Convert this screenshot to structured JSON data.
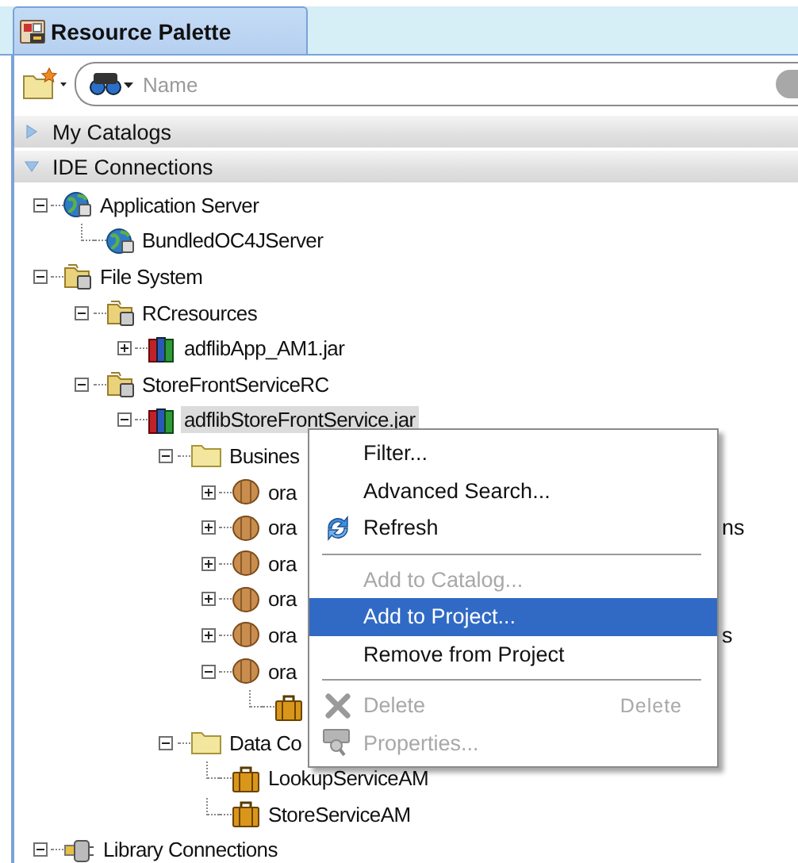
{
  "panel": {
    "title": "Resource Palette"
  },
  "search": {
    "placeholder": "Name"
  },
  "sections": [
    {
      "label": "My Catalogs",
      "expanded": false
    },
    {
      "label": "IDE Connections",
      "expanded": true
    }
  ],
  "tree": [
    {
      "label": "Application Server",
      "kind": "server",
      "expanded": true,
      "selected": false,
      "children": [
        {
          "label": "BundledOC4JServer",
          "kind": "server",
          "selected": false
        }
      ]
    },
    {
      "label": "File System",
      "kind": "filesystem",
      "expanded": true,
      "selected": false,
      "children": [
        {
          "label": "RCresources",
          "kind": "filesystem",
          "expanded": true,
          "selected": false,
          "children": [
            {
              "label": "adflibApp_AM1.jar",
              "kind": "jar",
              "expanded": false,
              "selected": false
            }
          ]
        },
        {
          "label": "StoreFrontServiceRC",
          "kind": "filesystem",
          "expanded": true,
          "selected": false,
          "children": [
            {
              "label": "adflibStoreFrontService.jar",
              "kind": "jar",
              "expanded": true,
              "selected": true,
              "children": [
                {
                  "label": "Busines",
                  "kind": "folder",
                  "expanded": true,
                  "selected": false,
                  "children": [
                    {
                      "label": "ora",
                      "kind": "package",
                      "expanded": false,
                      "selected": false
                    },
                    {
                      "label": "ora",
                      "tail": "ns",
                      "kind": "package",
                      "expanded": false,
                      "selected": false
                    },
                    {
                      "label": "ora",
                      "kind": "package",
                      "expanded": false,
                      "selected": false
                    },
                    {
                      "label": "ora",
                      "kind": "package",
                      "expanded": false,
                      "selected": false
                    },
                    {
                      "label": "ora",
                      "tail": "s",
                      "kind": "package",
                      "expanded": false,
                      "selected": false
                    },
                    {
                      "label": "ora",
                      "kind": "package",
                      "expanded": true,
                      "selected": false,
                      "children": [
                        {
                          "kind": "module"
                        }
                      ]
                    }
                  ]
                },
                {
                  "label": "Data Co",
                  "kind": "folder",
                  "expanded": true,
                  "selected": false,
                  "children": [
                    {
                      "label": "LookupServiceAM",
                      "kind": "module",
                      "selected": false
                    },
                    {
                      "label": "StoreServiceAM",
                      "kind": "module",
                      "selected": false
                    }
                  ]
                }
              ]
            }
          ]
        }
      ]
    },
    {
      "label": "Library Connections",
      "kind": "plug",
      "expanded": true,
      "selected": false
    }
  ],
  "context_menu": [
    {
      "kind": "item",
      "label": "Filter...",
      "disabled": false,
      "selected": false
    },
    {
      "kind": "item",
      "label": "Advanced Search...",
      "disabled": false,
      "selected": false
    },
    {
      "kind": "refresh",
      "label": "Refresh",
      "disabled": false,
      "selected": false
    },
    {
      "kind": "separator"
    },
    {
      "kind": "item",
      "label": "Add to Catalog...",
      "disabled": true,
      "selected": false
    },
    {
      "kind": "item",
      "label": "Add to Project...",
      "disabled": false,
      "selected": true
    },
    {
      "kind": "item",
      "label": "Remove from Project",
      "disabled": false,
      "selected": false
    },
    {
      "kind": "separator"
    },
    {
      "kind": "delete",
      "label": "Delete",
      "shortcut": "Delete",
      "disabled": true,
      "selected": false
    },
    {
      "kind": "properties",
      "label": "Properties...",
      "disabled": true,
      "selected": false
    }
  ]
}
